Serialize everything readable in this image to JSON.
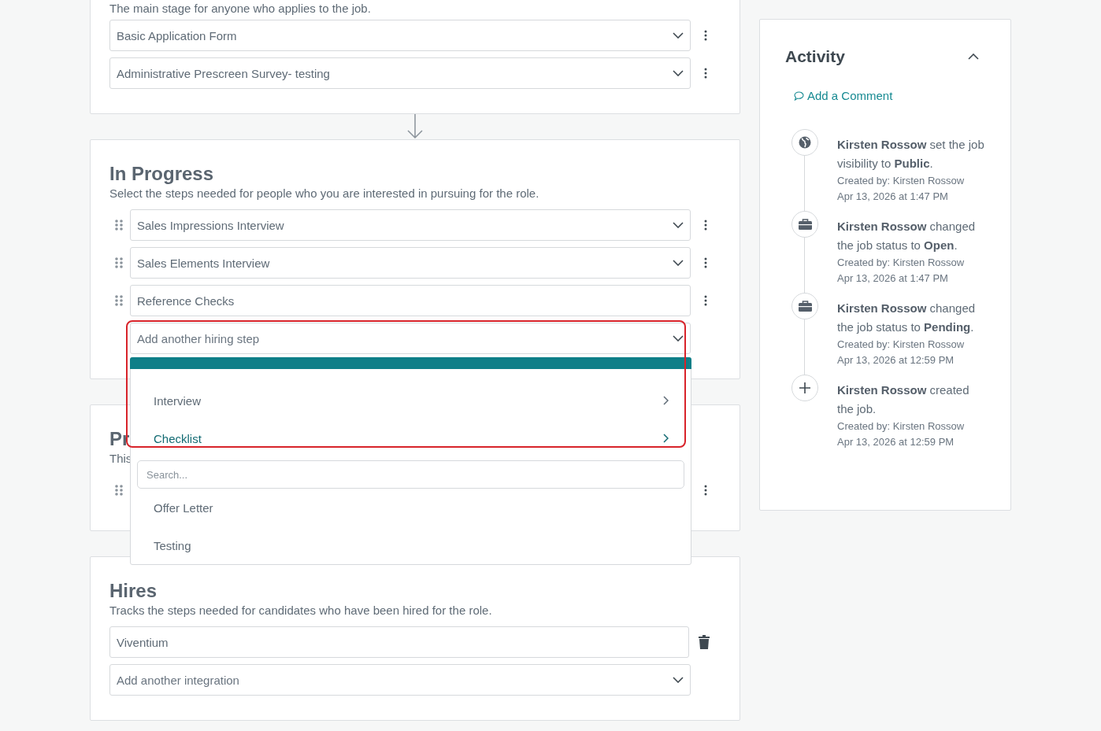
{
  "stages": [
    {
      "description": "The main stage for anyone who applies to the job.",
      "draggable": false,
      "steps": [
        {
          "kind": "select",
          "value": "Basic Application Form"
        },
        {
          "kind": "select",
          "value": "Administrative Prescreen Survey- testing"
        }
      ]
    },
    {
      "title": "In Progress",
      "description": "Select the steps needed for people who you are interested in pursuing for the role.",
      "draggable": true,
      "steps": [
        {
          "kind": "select",
          "value": "Sales Impressions Interview"
        },
        {
          "kind": "select",
          "value": "Sales Elements Interview"
        },
        {
          "kind": "text",
          "value": "Reference Checks"
        },
        {
          "kind": "adder",
          "placeholder": "Add another hiring step",
          "dropdown": {
            "items": [
              {
                "kind": "category",
                "label": "Interview",
                "selected": false
              },
              {
                "kind": "category",
                "label": "Checklist",
                "selected": true
              },
              {
                "kind": "search",
                "placeholder": "Search..."
              },
              {
                "kind": "option",
                "label": "Offer Letter",
                "selected": false
              },
              {
                "kind": "option",
                "label": "Testing",
                "selected": false
              }
            ]
          }
        }
      ]
    },
    {
      "title": "Pr",
      "description": "This",
      "draggable": true,
      "steps": [
        {
          "kind": "hidden"
        }
      ]
    },
    {
      "title": "Hires",
      "description": "Tracks the steps needed for candidates who have been hired for the role.",
      "draggable": false,
      "steps": [
        {
          "kind": "integration",
          "value": "Viventium"
        },
        {
          "kind": "integration-adder",
          "placeholder": "Add another integration"
        }
      ]
    }
  ],
  "activity": {
    "title": "Activity",
    "expanded": true,
    "add_comment": "Add a Comment",
    "entries": [
      {
        "kind": "visibility",
        "text": "**Kirsten Rossow** set the job visibility to **Public**.",
        "created_by": "Created by: Kirsten Rossow",
        "time": "Apr 13, 2026 at 1:47 PM"
      },
      {
        "kind": "status",
        "text": "**Kirsten Rossow** changed the job status to **Open**.",
        "created_by": "Created by: Kirsten Rossow",
        "time": "Apr 13, 2026 at 1:47 PM"
      },
      {
        "kind": "status",
        "text": "**Kirsten Rossow** changed the job status to **Pending**.",
        "created_by": "Created by: Kirsten Rossow",
        "time": "Apr 13, 2026 at 12:59 PM"
      },
      {
        "kind": "created",
        "text": "**Kirsten Rossow** created the job.",
        "created_by": "Created by: Kirsten Rossow",
        "time": "Apr 13, 2026 at 12:59 PM"
      }
    ]
  }
}
